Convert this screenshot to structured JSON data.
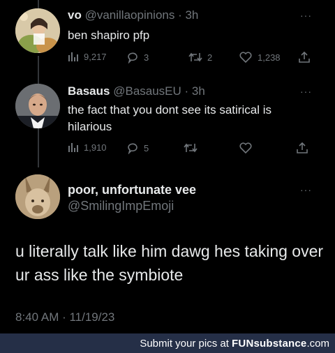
{
  "tweets": [
    {
      "name": "vo",
      "meta": "@vanillaopinions · 3h",
      "text": "ben shapiro pfp",
      "views": "9,217",
      "replies": "3",
      "retweets": "2",
      "likes": "1,238"
    },
    {
      "name": "Basaus",
      "meta": "@BasausEU · 3h",
      "text": "the fact that you dont see its satirical is hilarious",
      "views": "1,910",
      "replies": "5",
      "retweets": "",
      "likes": ""
    }
  ],
  "main": {
    "name": "poor, unfortunate vee",
    "handle": "@SmilingImpEmoji",
    "text": "u literally talk like him dawg hes taking over ur ass like the symbiote",
    "timestamp": "8:40 AM · 11/19/23"
  },
  "footer": {
    "prefix": "Submit your pics at ",
    "brand": "FUNsubstance",
    "suffix": ".com"
  },
  "more_label": "···",
  "icons": {
    "views": "bar-chart-icon",
    "reply": "reply-icon",
    "retweet": "retweet-icon",
    "like": "heart-icon",
    "share": "share-icon"
  }
}
